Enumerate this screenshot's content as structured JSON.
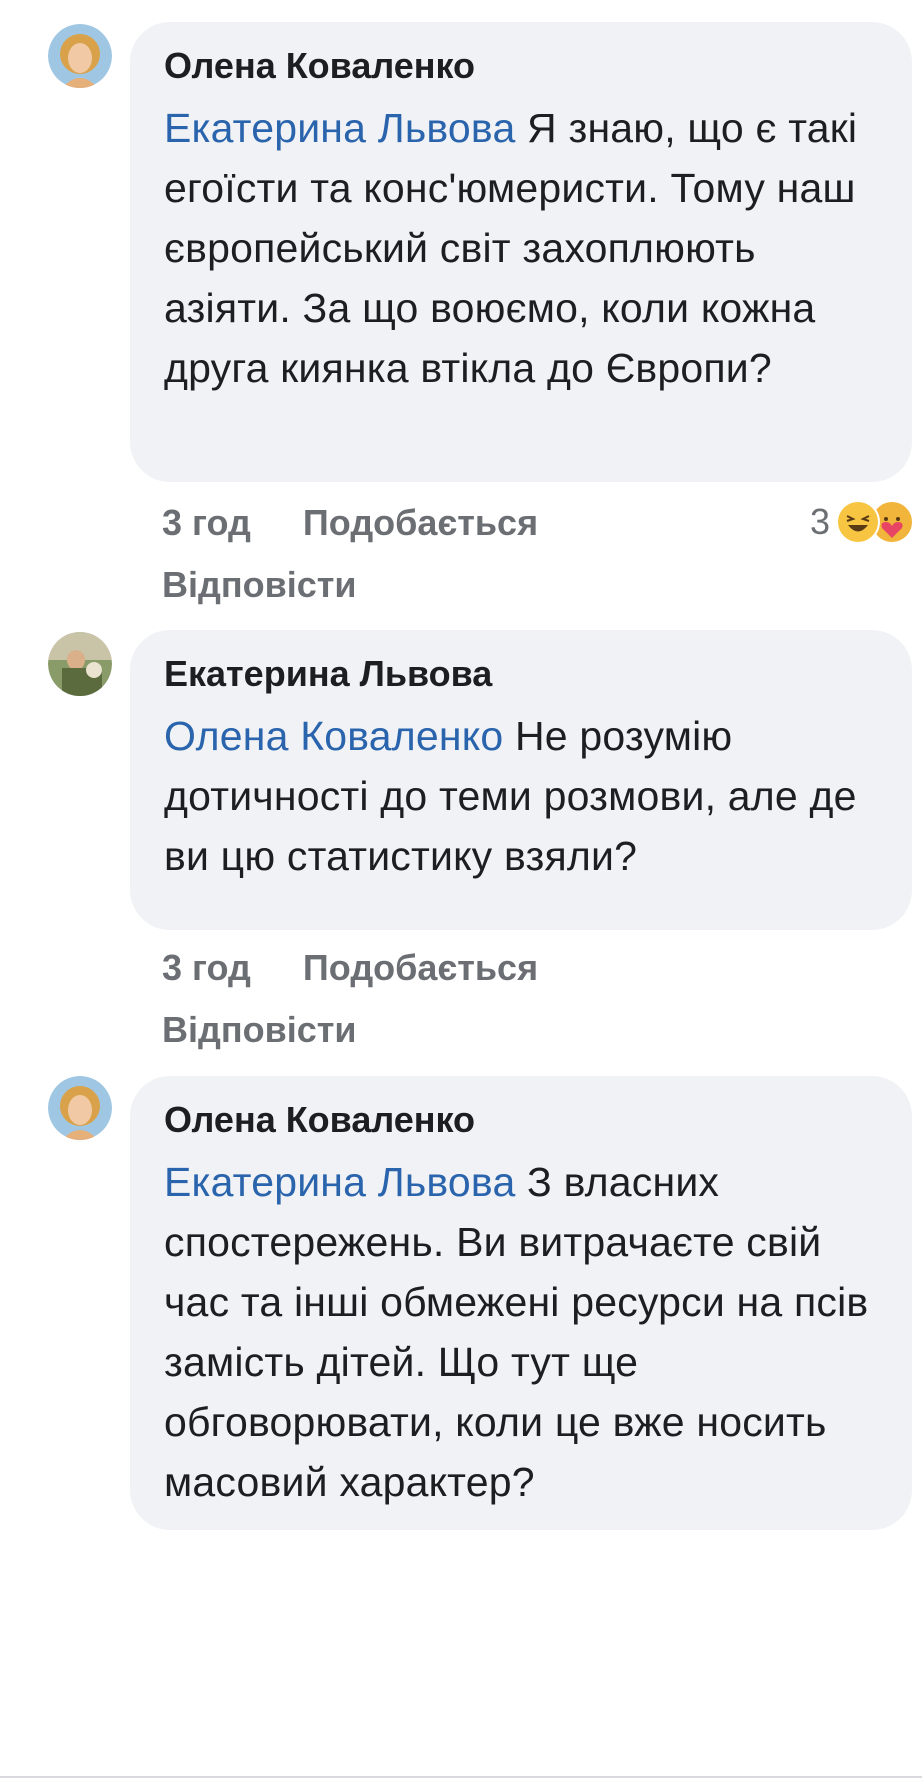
{
  "comments": [
    {
      "author": "Олена Коваленко",
      "mention": "Екатерина Львова",
      "text": " Я знаю, що є такі егоїсти та конс'юмеристи. Тому наш європейський світ захоплюють азіяти. За що воюємо, коли кожна друга киянка втікла до Європи?",
      "time": "3 год",
      "like_label": "Подобається",
      "reply_label": "Відповісти",
      "reaction_count": "3",
      "reaction_icons": [
        "laughing-emoji-icon",
        "care-emoji-icon"
      ]
    },
    {
      "author": "Екатерина Львова",
      "mention": "Олена Коваленко",
      "text": " Не розумію дотичності до теми розмови, але де ви цю статистику взяли?",
      "time": "3 год",
      "like_label": "Подобається",
      "reply_label": "Відповісти"
    },
    {
      "author": "Олена Коваленко",
      "mention": "Екатерина Львова",
      "text": " З власних спостережень. Ви витрачаєте свій час та інші обмежені ресурси на псів замість дітей. Що тут ще обговорювати, коли це вже носить масовий характер?"
    }
  ],
  "colors": {
    "bubble": "#f0f2f5",
    "mention": "#2a64ad",
    "meta_text": "#6b6e73",
    "body_text": "#1c1e21"
  }
}
